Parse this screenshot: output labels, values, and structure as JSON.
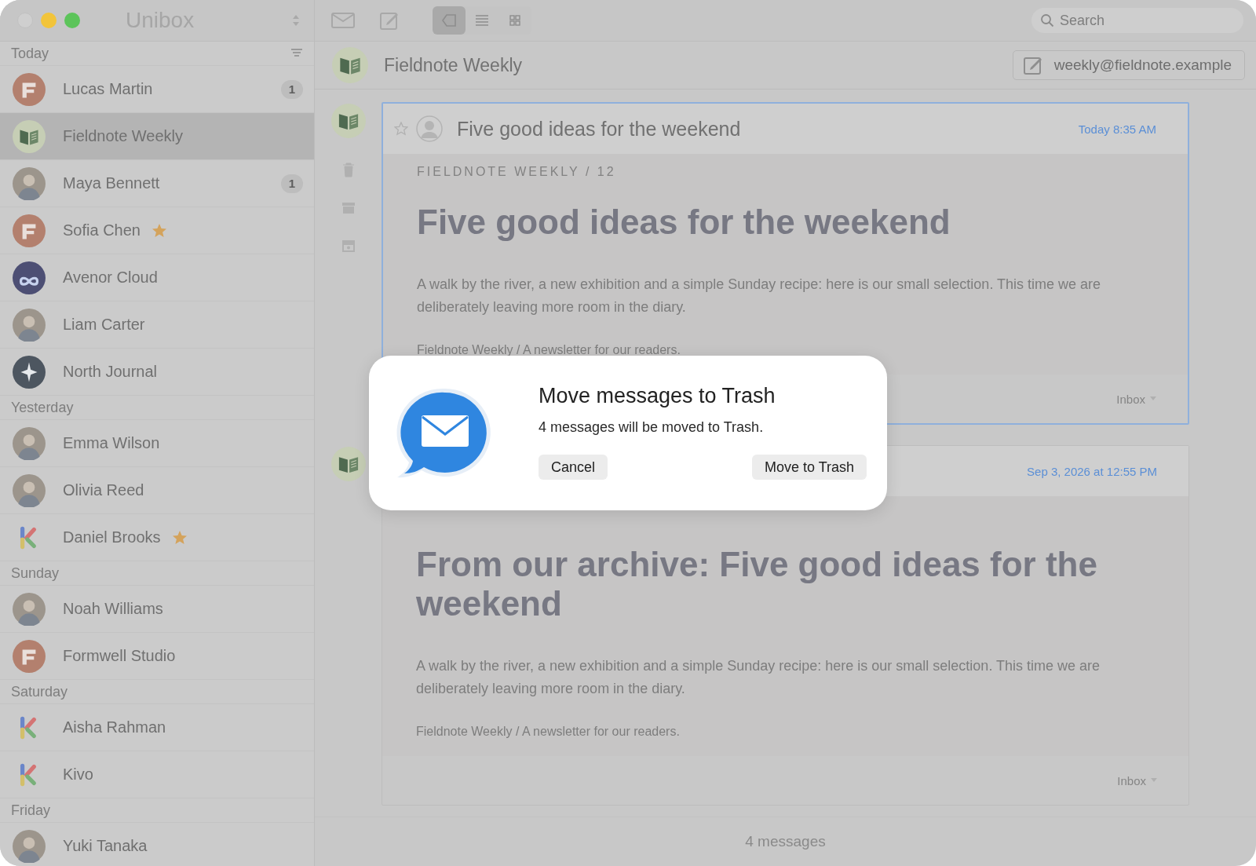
{
  "window": {
    "title": "Unibox"
  },
  "toolbar": {
    "view_modes": [
      {
        "kind": "conversation",
        "selected": true
      },
      {
        "kind": "list",
        "selected": false
      },
      {
        "kind": "grid",
        "selected": false
      }
    ],
    "search": {
      "placeholder": "Search"
    }
  },
  "sidebar": {
    "sections": [
      {
        "label": "Today",
        "items": [
          {
            "name": "Lucas Martin",
            "kind": "f-logo",
            "badge": "1",
            "starred": false,
            "selected": false
          },
          {
            "name": "Fieldnote Weekly",
            "kind": "book",
            "starred": false,
            "selected": true
          },
          {
            "name": "Maya Bennett",
            "kind": "photo",
            "badge": "1",
            "starred": false,
            "selected": false
          },
          {
            "name": "Sofia Chen",
            "kind": "f-logo",
            "starred": true,
            "selected": false
          },
          {
            "name": "Avenor Cloud",
            "kind": "cloud",
            "starred": false,
            "selected": false
          },
          {
            "name": "Liam Carter",
            "kind": "photo",
            "starred": false,
            "selected": false
          },
          {
            "name": "North Journal",
            "kind": "star-logo",
            "starred": false,
            "selected": false
          }
        ]
      },
      {
        "label": "Yesterday",
        "items": [
          {
            "name": "Emma Wilson",
            "kind": "photo",
            "starred": false,
            "selected": false
          },
          {
            "name": "Olivia Reed",
            "kind": "photo",
            "starred": false,
            "selected": false
          },
          {
            "name": "Daniel Brooks",
            "kind": "k-logo",
            "starred": true,
            "selected": false
          }
        ]
      },
      {
        "label": "Sunday",
        "items": [
          {
            "name": "Noah Williams",
            "kind": "photo",
            "starred": false,
            "selected": false
          },
          {
            "name": "Formwell Studio",
            "kind": "f-logo",
            "starred": false,
            "selected": false
          }
        ]
      },
      {
        "label": "Saturday",
        "items": [
          {
            "name": "Aisha Rahman",
            "kind": "k-logo",
            "starred": false,
            "selected": false
          },
          {
            "name": "Kivo",
            "kind": "k-logo",
            "starred": false,
            "selected": false
          }
        ]
      },
      {
        "label": "Friday",
        "items": [
          {
            "name": "Yuki Tanaka",
            "kind": "photo",
            "starred": false,
            "selected": false
          }
        ]
      }
    ]
  },
  "conversation": {
    "title": "Fieldnote Weekly",
    "address": "weekly@fieldnote.example"
  },
  "messages": [
    {
      "subject": "Five good ideas for the weekend",
      "starred": false,
      "date": "Today 8:35 AM",
      "overline": "FIELDNOTE WEEKLY / 12",
      "heading": "Five good ideas for the weekend",
      "body": "A walk by the river, a new exhibition and a simple Sunday recipe: here is our small selection. This time we are deliberately leaving more room in the diary.",
      "footer": "Fieldnote Weekly / A newsletter for our readers.",
      "folder": "Inbox",
      "selected": true
    },
    {
      "date": "Sep 3, 2026 at 12:55 PM",
      "heading": "From our archive: Five good ideas for the weekend",
      "body": "A walk by the river, a new exhibition and a simple Sunday recipe: here is our small selection. This time we are deliberately leaving more room in the diary.",
      "footer": "Fieldnote Weekly / A newsletter for our readers.",
      "folder": "Inbox",
      "selected": false
    }
  ],
  "status_bar": {
    "text": "4 messages"
  },
  "dialog": {
    "title": "Move messages to Trash",
    "message": "4 messages will be moved to Trash.",
    "buttons": [
      {
        "label": "Cancel"
      },
      {
        "label": "Move to Trash"
      }
    ]
  }
}
